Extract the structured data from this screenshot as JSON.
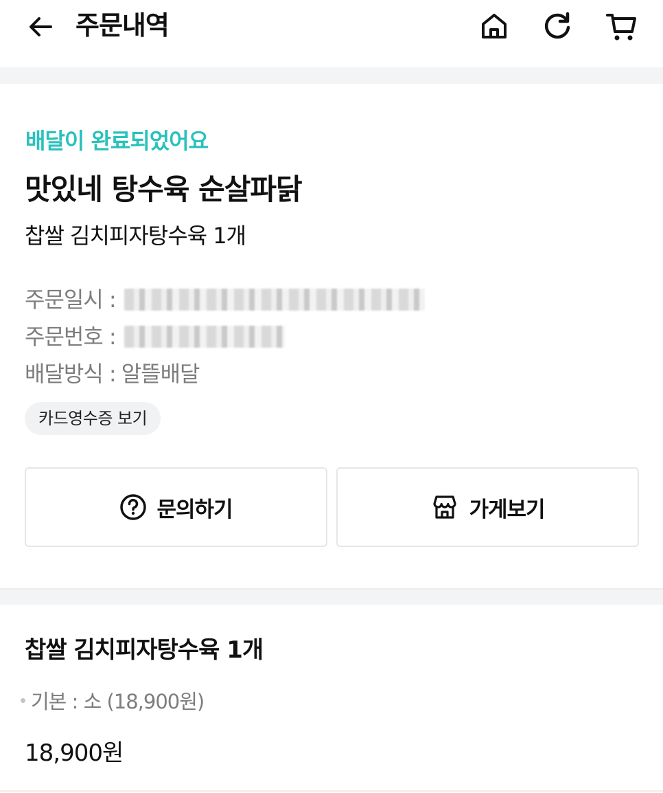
{
  "header": {
    "title": "주문내역",
    "icons": [
      "back-arrow-icon",
      "home-icon",
      "refresh-icon",
      "cart-icon"
    ]
  },
  "order": {
    "status": "배달이 완료되었어요",
    "status_color": "#2ac1bc",
    "store_name": "맛있네 탕수육 순살파닭",
    "item_summary": "찹쌀 김치피자탕수육 1개",
    "info": {
      "date_label": "주문일시 :",
      "number_label": "주문번호 :",
      "delivery_label": "배달방식 :",
      "delivery_value": "알뜰배달"
    },
    "receipt_button": "카드영수증 보기",
    "inquiry_button": "문의하기",
    "store_button": "가게보기"
  },
  "detail": {
    "item_title": "찹쌀 김치피자탕수육 1개",
    "option": "기본 : 소 (18,900원)",
    "price": "18,900원"
  }
}
